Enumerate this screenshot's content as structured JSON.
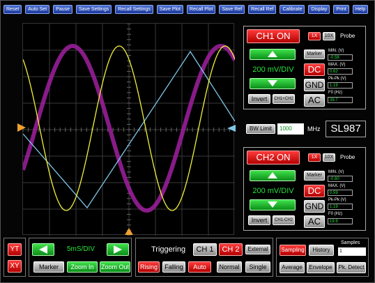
{
  "menu": [
    "Reset",
    "Auto Set",
    "Pause",
    "Save Settings",
    "Recall Settings",
    "Save Plot",
    "Recall Plot",
    "Save Ref",
    "Recall Ref",
    "Calibrate",
    "Display",
    "Print",
    "Help"
  ],
  "ch1": {
    "title": "CH1 ON",
    "scale": "200 mV/DIV",
    "x1": "1X",
    "x10": "10X",
    "probe": "Probe",
    "marker": "Marker",
    "dc": "DC",
    "gnd": "GND",
    "ac": "AC",
    "invert": "Invert",
    "math": "CH1+CH2",
    "min_label": "MIN. (V)",
    "min": "-0.58",
    "max_label": "MAX. (V)",
    "max": "0.62",
    "pkpk_label": "Pk-Pk (V)",
    "pkpk": "1.19",
    "f0_label": "F0 (Hz)",
    "f0": "39.7"
  },
  "ch2": {
    "title": "CH2 ON",
    "scale": "200 mV/DIV",
    "x1": "1X",
    "x10": "10X",
    "probe": "Probe",
    "marker": "Marker",
    "dc": "DC",
    "gnd": "GND",
    "ac": "AC",
    "invert": "Invert",
    "math": "CH1-CH2",
    "min_label": "MIN. (V)",
    "min": "-0.60",
    "max_label": "MAX. (V)",
    "max": "0.59",
    "pkpk_label": "Pk-Pk (V)",
    "pkpk": "1.19",
    "f0_label": "F0 (Hz)",
    "f0": "19.9"
  },
  "bw": {
    "label": "BW Limit",
    "value": "1000",
    "unit": "MHz"
  },
  "model": "SL987",
  "mode": {
    "yt": "YT",
    "xy": "XY"
  },
  "timebase": {
    "value": "5mS/DIV",
    "marker": "Marker",
    "zoom_in": "Zoom In",
    "zoom_out": "Zoom Out"
  },
  "trigger": {
    "title": "Triggering",
    "ch1": "CH 1",
    "ch2": "CH 2",
    "external": "External",
    "rising": "Rising",
    "falling": "Falling",
    "auto": "Auto",
    "normal": "Normal",
    "single": "Single"
  },
  "acq": {
    "sampling": "Sampling",
    "history": "History",
    "samples_label": "Samples",
    "samples": "1",
    "average": "Average",
    "envelope": "Envelope",
    "pk_detect": "Pk. Detect"
  },
  "colors": {
    "ch1": "#f2f23a",
    "ch2": "#7fc8e8",
    "ref": "#a020a0",
    "marker": "#f0a030"
  }
}
